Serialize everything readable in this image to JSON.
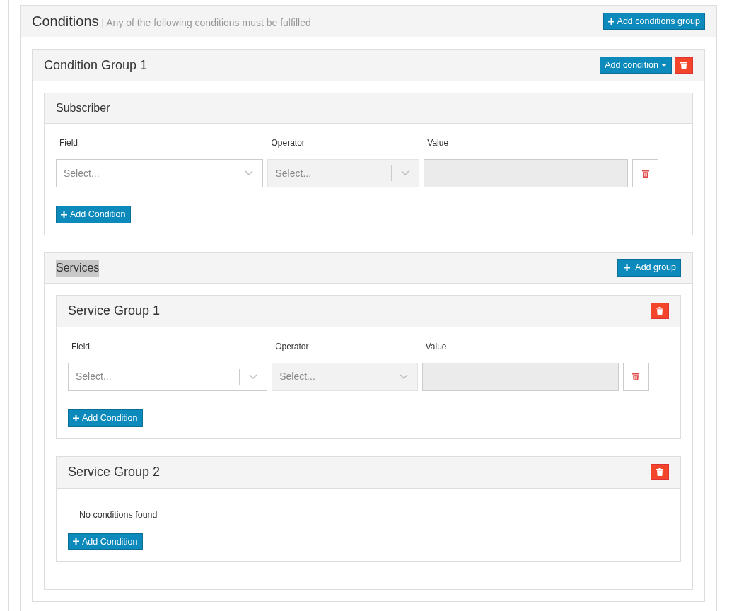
{
  "conditions": {
    "title": "Conditions",
    "subtitle": "| Any of the following conditions must be fulfilled",
    "add_button": "Add conditions group",
    "groups": [
      {
        "title": "Condition Group 1",
        "add_button": "Add condition",
        "sections": [
          {
            "kind": "conditions",
            "title": "Subscriber",
            "labels": {
              "field": "Field",
              "operator": "Operator",
              "value": "Value"
            },
            "rows": [
              {
                "field": {
                  "placeholder": "Select...",
                  "disabled": false
                },
                "operator": {
                  "placeholder": "Select...",
                  "disabled": true
                },
                "value": {
                  "disabled": true
                }
              }
            ],
            "add_button": "Add Condition"
          },
          {
            "kind": "groups",
            "title": "Services",
            "add_button": "Add group",
            "groups": [
              {
                "title": "Service Group 1",
                "labels": {
                  "field": "Field",
                  "operator": "Operator",
                  "value": "Value"
                },
                "rows": [
                  {
                    "field": {
                      "placeholder": "Select...",
                      "disabled": false
                    },
                    "operator": {
                      "placeholder": "Select...",
                      "disabled": true
                    },
                    "value": {
                      "disabled": true
                    }
                  }
                ],
                "add_button": "Add Condition"
              },
              {
                "title": "Service Group 2",
                "empty_text": "No conditions found",
                "add_button": "Add Condition"
              }
            ]
          }
        ]
      }
    ]
  }
}
